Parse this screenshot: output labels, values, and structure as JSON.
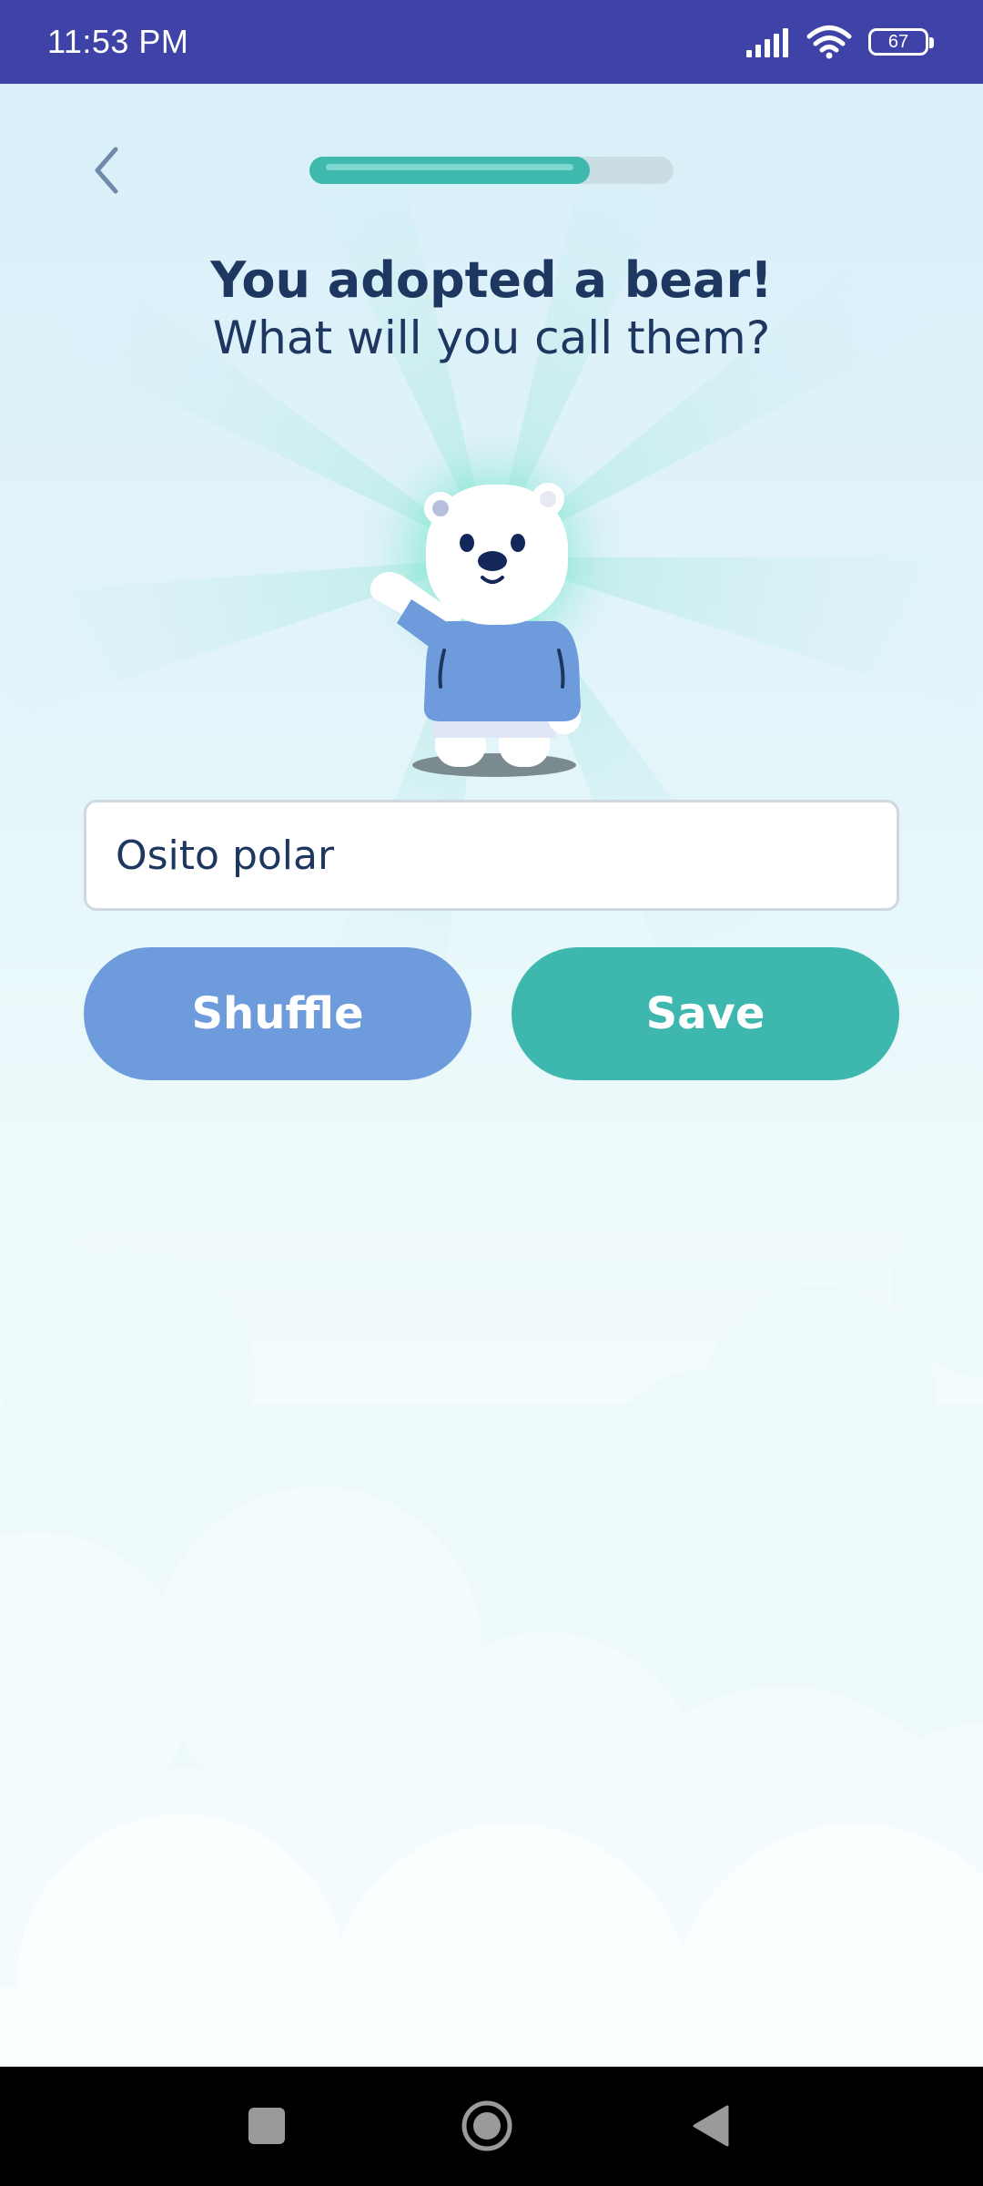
{
  "status_bar": {
    "time": "11:53 PM",
    "battery": "67",
    "icons": [
      "signal-icon",
      "wifi-icon",
      "battery-icon"
    ]
  },
  "header": {
    "back_icon": "chevron-left-icon",
    "progress": 0.77
  },
  "main": {
    "title": "You adopted a bear!",
    "subtitle": "What will you call them?",
    "mascot": "polar-bear-illustration"
  },
  "form": {
    "name_value": "Osito polar"
  },
  "actions": {
    "shuffle_label": "Shuffle",
    "save_label": "Save"
  },
  "nav_bar": {
    "icons": [
      "recents-square-icon",
      "home-circle-icon",
      "back-triangle-icon"
    ]
  },
  "colors": {
    "status_bar": "#3f43a8",
    "title_text": "#1d3760",
    "shuffle_button": "#6d9bdc",
    "save_button": "#3eb8ae",
    "progress_fill": "#3fb9ad",
    "progress_track": "#c9dde3"
  }
}
